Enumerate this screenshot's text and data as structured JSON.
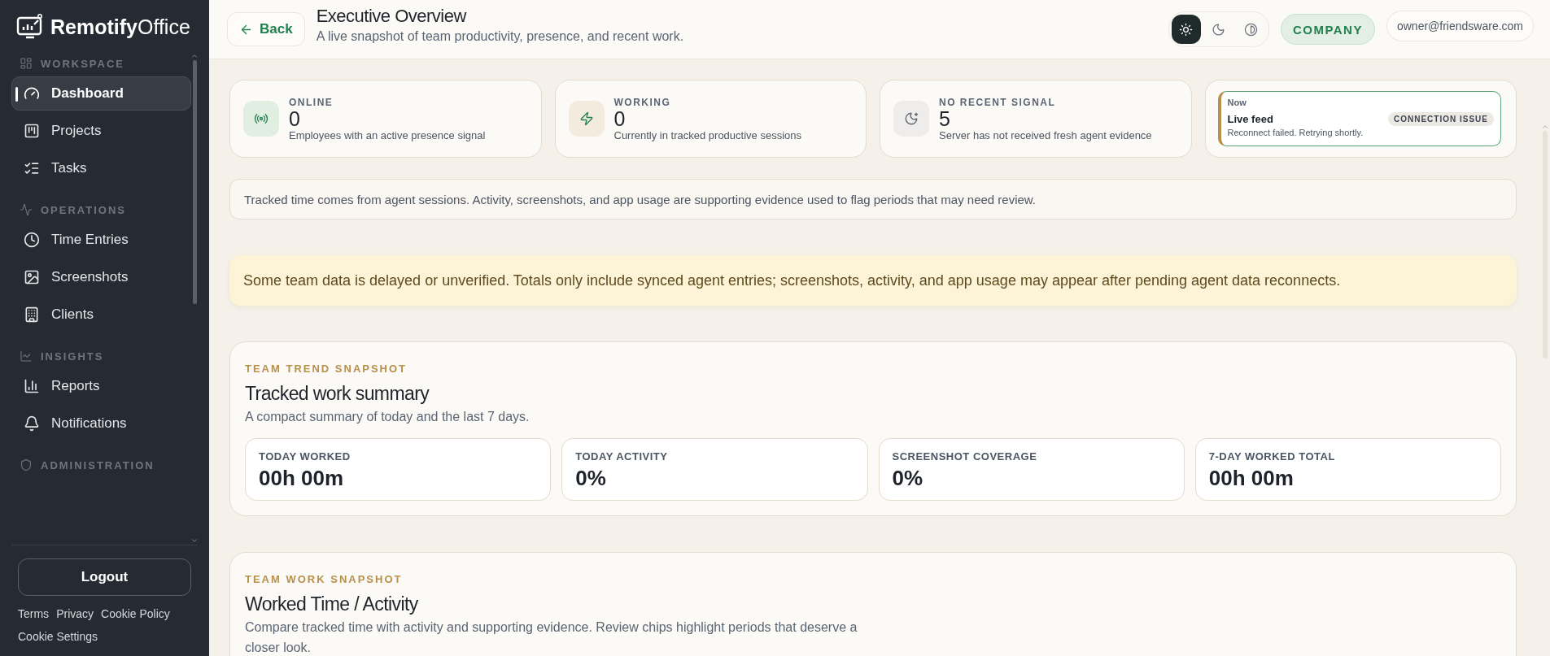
{
  "brand": {
    "name_bold": "Remotify",
    "name_light": "Office"
  },
  "sidebar": {
    "sections": [
      {
        "title": "WORKSPACE",
        "kind": "layout",
        "items": [
          {
            "label": "Dashboard",
            "kind": "gauge",
            "selected": true
          },
          {
            "label": "Projects",
            "kind": "kanban",
            "selected": false
          },
          {
            "label": "Tasks",
            "kind": "list",
            "selected": false
          }
        ]
      },
      {
        "title": "OPERATIONS",
        "kind": "pulse",
        "items": [
          {
            "label": "Time Entries",
            "kind": "clock",
            "selected": false
          },
          {
            "label": "Screenshots",
            "kind": "image",
            "selected": false
          },
          {
            "label": "Clients",
            "kind": "building",
            "selected": false
          }
        ]
      },
      {
        "title": "INSIGHTS",
        "kind": "chart",
        "items": [
          {
            "label": "Reports",
            "kind": "bars",
            "selected": false
          },
          {
            "label": "Notifications",
            "kind": "bell",
            "selected": false
          }
        ]
      },
      {
        "title": "ADMINISTRATION",
        "kind": "shield"
      }
    ],
    "logout": "Logout",
    "links": [
      "Terms",
      "Privacy",
      "Cookie Policy",
      "Cookie Settings"
    ]
  },
  "header": {
    "back": "Back",
    "title": "Executive Overview",
    "subtitle": "A live snapshot of team productivity, presence, and recent work.",
    "themes": [
      {
        "kind": "light",
        "selected": true
      },
      {
        "kind": "dark",
        "selected": false
      },
      {
        "kind": "contrast",
        "selected": false
      }
    ],
    "role": "COMPANY",
    "user": "owner@friendsware.com"
  },
  "stats": [
    {
      "kind": "online",
      "label": "ONLINE",
      "value": "0",
      "note": "Employees with an active presence signal"
    },
    {
      "kind": "working",
      "label": "WORKING",
      "value": "0",
      "note": "Currently in tracked productive sessions"
    },
    {
      "kind": "idle",
      "label": "NO RECENT SIGNAL",
      "value": "5",
      "note": "Server has not received fresh agent evidence"
    }
  ],
  "feed": {
    "time": "Now",
    "title": "Live feed",
    "status": "CONNECTION ISSUE",
    "message": "Reconnect failed. Retrying shortly."
  },
  "info": "Tracked time comes from agent sessions. Activity, screenshots, and app usage are supporting evidence used to flag periods that may need review.",
  "warning": "Some team data is delayed or unverified. Totals only include synced agent entries; screenshots, activity, and app usage may appear after pending agent data reconnects.",
  "trend": {
    "eyebrow": "TEAM TREND SNAPSHOT",
    "title": "Tracked work summary",
    "subtitle": "A compact summary of today and the last 7 days.",
    "metrics": [
      {
        "label": "TODAY WORKED",
        "value": "00h 00m"
      },
      {
        "label": "TODAY ACTIVITY",
        "value": "0%"
      },
      {
        "label": "SCREENSHOT COVERAGE",
        "value": "0%"
      },
      {
        "label": "7-DAY WORKED TOTAL",
        "value": "00h 00m"
      }
    ]
  },
  "work": {
    "eyebrow": "TEAM WORK SNAPSHOT",
    "title": "Worked Time / Activity",
    "subtitle": "Compare tracked time with activity and supporting evidence. Review chips highlight periods that deserve a closer look."
  }
}
